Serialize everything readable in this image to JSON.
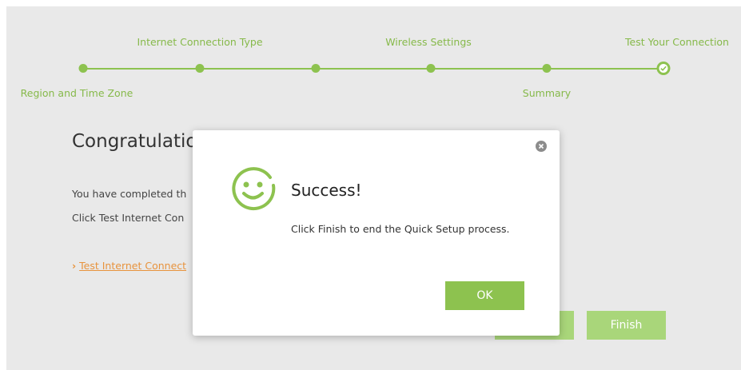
{
  "steps": [
    {
      "label": "Region and Time Zone",
      "position": "bottom",
      "status": "completed"
    },
    {
      "label": "Internet Connection Type",
      "position": "top",
      "status": "completed"
    },
    {
      "label": "",
      "position": "none",
      "status": "completed"
    },
    {
      "label": "Wireless Settings",
      "position": "top",
      "status": "completed"
    },
    {
      "label": "Summary",
      "position": "bottom",
      "status": "completed"
    },
    {
      "label": "Test Your Connection",
      "position": "top",
      "status": "current"
    }
  ],
  "main": {
    "heading": "Congratulatio",
    "line1": "You have completed th",
    "line2": "Click Test Internet Con",
    "test_link": "Test Internet Connect",
    "back_label": "",
    "finish_label": "Finish"
  },
  "modal": {
    "icon": "smiley-icon",
    "title": "Success!",
    "message": "Click Finish to end the Quick Setup process.",
    "ok_label": "OK"
  },
  "colors": {
    "accent": "#8dc24f",
    "accent_light": "#a9d67a",
    "link": "#e8933d",
    "background": "#e9e9e9"
  }
}
